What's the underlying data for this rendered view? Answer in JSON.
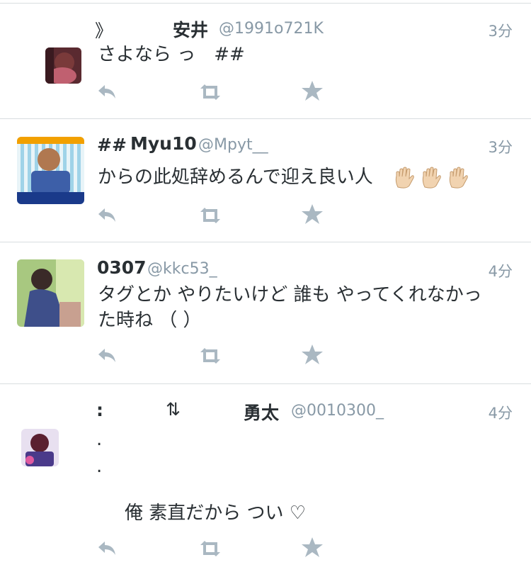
{
  "colors": {
    "action_icon": "#aab8c2",
    "handle": "#8899a6",
    "text": "#292f33",
    "divider": "#d8dde0"
  },
  "tweets": [
    {
      "name_prefix": "》",
      "name": "安井",
      "handle": "@1991o721K",
      "time": "3分",
      "lines": [
        "さよなら っ　##"
      ]
    },
    {
      "name_prefix": "##",
      "name": "Myu10",
      "handle": "@Mpyt__",
      "time": "3分",
      "lines": [
        "からの此処辞めるんで迎え良い人"
      ],
      "emoji": [
        "raised-hand",
        "raised-hand",
        "raised-hand"
      ]
    },
    {
      "name": "0307",
      "handle": "@kkc53_",
      "time": "4分",
      "lines": [
        "タグとか やりたいけど 誰も やってくれなかっ",
        "た時ね （ ）"
      ]
    },
    {
      "name_prefix": ":",
      "name_mid": "⇅",
      "name": "勇太",
      "handle": "@0010300_",
      "time": "4分",
      "lines": [
        ".",
        ".",
        "",
        "　俺 素直だから つい ♡"
      ]
    }
  ]
}
